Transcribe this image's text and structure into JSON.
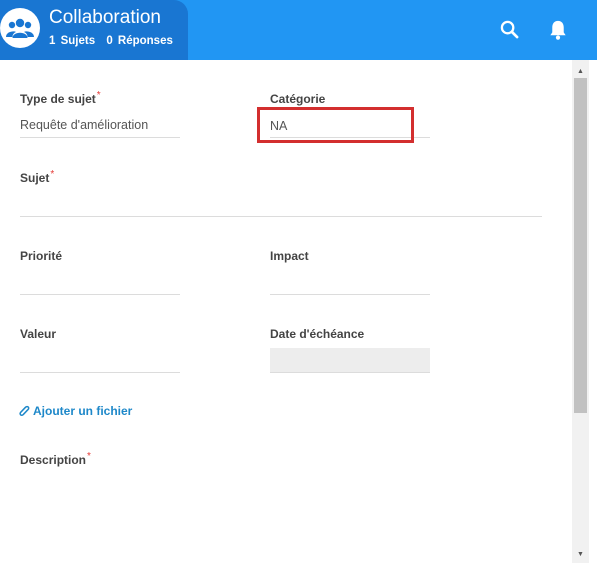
{
  "header": {
    "title": "Collaboration",
    "topics": "1 Sujets",
    "replies": "0 Réponses",
    "icons": {
      "avatar": "users-icon",
      "search": "search-icon",
      "notifications": "bell-icon"
    },
    "colors": {
      "bar": "#2196f3",
      "title_block": "#1976d2"
    }
  },
  "form": {
    "type_label": "Type de sujet",
    "type_value": "Requête d'amélioration",
    "category_label": "Catégorie",
    "category_value": "NA",
    "subject_label": "Sujet",
    "subject_value": "",
    "priority_label": "Priorité",
    "priority_value": "",
    "impact_label": "Impact",
    "impact_value": "",
    "value_label": "Valeur",
    "value_value": "",
    "due_label": "Date d'échéance",
    "due_value": "",
    "attach_label": "Ajouter un fichier",
    "description_label": "Description",
    "required_marker": "*",
    "colors": {
      "required": "#e53935",
      "link": "#1e88c9",
      "highlight": "#d32f2f"
    }
  }
}
